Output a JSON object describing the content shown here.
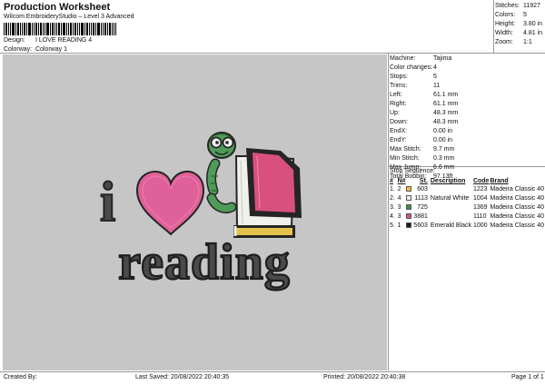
{
  "header": {
    "title": "Production Worksheet",
    "subtitle": "Wilcom EmbroideryStudio – Level 3 Advanced"
  },
  "meta": {
    "design_label": "Design:",
    "design_value": "I LOVE READING 4",
    "colorway_label": "Colorway:",
    "colorway_value": "Colorway 1"
  },
  "stats": [
    {
      "label": "Stitches:",
      "value": "11927"
    },
    {
      "label": "Colors:",
      "value": "5"
    },
    {
      "label": "Height:",
      "value": "3.80 in"
    },
    {
      "label": "Width:",
      "value": "4.81 in"
    },
    {
      "label": "Zoom:",
      "value": "1:1"
    }
  ],
  "machine_info": [
    {
      "label": "Machine:",
      "value": "Tajima"
    },
    {
      "label": "Color changes:",
      "value": "4"
    },
    {
      "label": "Stops:",
      "value": "5"
    },
    {
      "label": "Trims:",
      "value": "11"
    },
    {
      "label": "Left:",
      "value": "61.1 mm"
    },
    {
      "label": "Right:",
      "value": "61.1 mm"
    },
    {
      "label": "Up:",
      "value": "48.3 mm"
    },
    {
      "label": "Down:",
      "value": "48.3 mm"
    },
    {
      "label": "EndX:",
      "value": "0.00 in"
    },
    {
      "label": "EndY:",
      "value": "0.00 in"
    },
    {
      "label": "Max Stitch:",
      "value": "9.7 mm"
    },
    {
      "label": "Min Stitch:",
      "value": "0.3 mm"
    },
    {
      "label": "Max Jump:",
      "value": "6.6 mm"
    },
    {
      "label": "Total Bobbin:",
      "value": "97.13ft"
    }
  ],
  "sequence": {
    "label": "Stop Sequence:",
    "headers": [
      "#",
      "N#",
      "St.",
      "Description",
      "Code",
      "Brand"
    ],
    "rows": [
      {
        "num": "1.",
        "n": "2",
        "color": "#f0c048",
        "st": "603",
        "desc": "",
        "code": "1223",
        "brand": "Madeira Classic 40"
      },
      {
        "num": "2.",
        "n": "4",
        "color": "#f2f2ee",
        "st": "1113",
        "desc": "Natural White",
        "code": "1004",
        "brand": "Madeira Classic 40"
      },
      {
        "num": "3.",
        "n": "3",
        "color": "#3f8f4f",
        "st": "725",
        "desc": "",
        "code": "1369",
        "brand": "Madeira Classic 40"
      },
      {
        "num": "4.",
        "n": "3",
        "color": "#d6507e",
        "st": "3881",
        "desc": "",
        "code": "1110",
        "brand": "Madeira Classic 40"
      },
      {
        "num": "5.",
        "n": "1",
        "color": "#1a1a1a",
        "st": "5603",
        "desc": "Emerald Black",
        "code": "1000",
        "brand": "Madeira Classic 40"
      }
    ]
  },
  "design_art": {
    "letter_i": "i",
    "word": "reading",
    "colors": {
      "heart": "#e0619a",
      "outline": "#252525",
      "worm": "#4e9b5a",
      "book_page": "#f0f0ec",
      "book_cover": "#d8507e",
      "book_spine": "#e2c24a",
      "text_fill": "#4a4a4a",
      "canvas": "#c6c6c6"
    }
  },
  "footer": {
    "created": "Created By:",
    "saved": "Last Saved: 20/08/2022 20:40:35",
    "printed": "Printed: 20/08/2022 20:40:38",
    "page": "Page 1 of 1"
  }
}
